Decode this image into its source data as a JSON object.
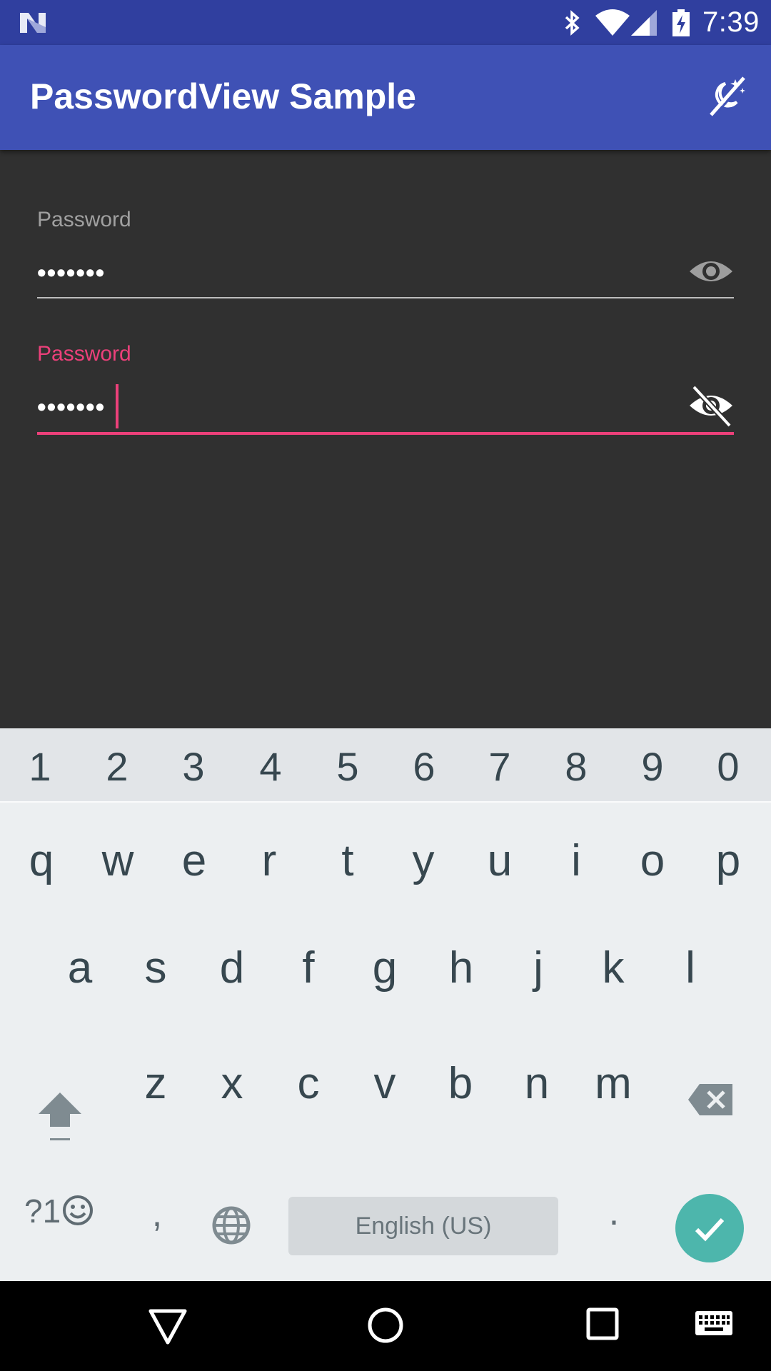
{
  "status_bar": {
    "time": "7:39",
    "icons": [
      "n-logo-icon",
      "bluetooth-icon",
      "wifi-icon",
      "cell-signal-icon",
      "battery-charging-icon"
    ]
  },
  "app_bar": {
    "title": "PasswordView Sample",
    "action_icon": "theme-toggle-icon"
  },
  "fields": [
    {
      "label": "Password",
      "value": "•••••••",
      "state": "unfocused",
      "toggle_icon": "eye-icon"
    },
    {
      "label": "Password",
      "value": "•••••••",
      "state": "focused",
      "toggle_icon": "eye-off-icon"
    }
  ],
  "keyboard": {
    "number_row": [
      "1",
      "2",
      "3",
      "4",
      "5",
      "6",
      "7",
      "8",
      "9",
      "0"
    ],
    "row1": [
      "q",
      "w",
      "e",
      "r",
      "t",
      "y",
      "u",
      "i",
      "o",
      "p"
    ],
    "row2": [
      "a",
      "s",
      "d",
      "f",
      "g",
      "h",
      "j",
      "k",
      "l"
    ],
    "row3": [
      "z",
      "x",
      "c",
      "v",
      "b",
      "n",
      "m"
    ],
    "symbols_label": "?1",
    "comma": ",",
    "space_label": "English (US)",
    "period": "."
  },
  "nav_bar": {
    "buttons": [
      "back-icon",
      "home-icon",
      "recents-icon",
      "keyboard-icon"
    ]
  },
  "colors": {
    "status_bar": "#303f9f",
    "app_bar": "#3f51b5",
    "background": "#303030",
    "accent": "#ec407a",
    "enter_button": "#4db6ac"
  }
}
